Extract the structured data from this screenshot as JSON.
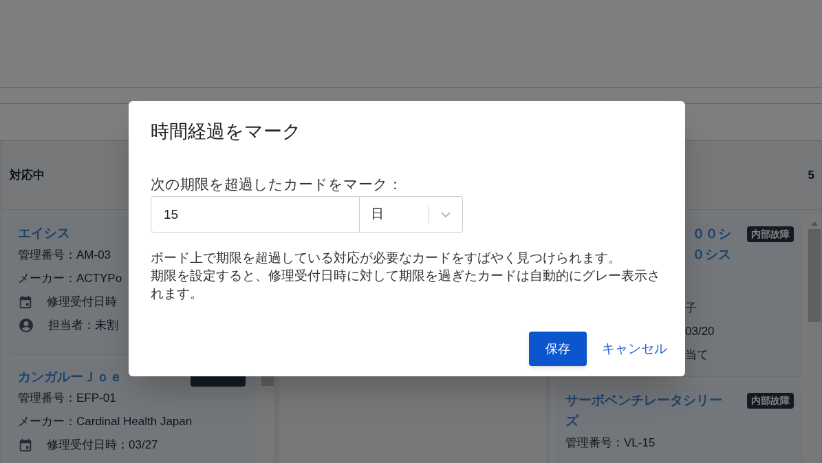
{
  "board": {
    "columns": [
      {
        "kind": "full",
        "title": "対応中",
        "cards": [
          {
            "title": "エイシス",
            "badge_hidden": false,
            "lines": [
              {
                "kind": "text",
                "text": "管理番号：AM-03"
              },
              {
                "kind": "text",
                "text": "メーカー：ACTYPo"
              },
              {
                "kind": "date",
                "text": "修理受付日時"
              },
              {
                "kind": "assignee",
                "text": "担当者：未割"
              }
            ]
          },
          {
            "title": "カンガルーＪｏｅ",
            "badge_hidden": true,
            "lines": [
              {
                "kind": "text",
                "text": "管理番号：EFP-01"
              },
              {
                "kind": "text",
                "text": "メーカー：Cardinal Health Japan"
              },
              {
                "kind": "date",
                "text": "修理受付日時：03/27"
              }
            ]
          }
        ]
      },
      {
        "kind": "covered",
        "count": "5",
        "cards": [
          {
            "title_lines": [
              "００シ",
              "０シス"
            ],
            "badge": "内部故障",
            "lines": [
              {
                "text": "子"
              },
              {
                "text": "03/20"
              },
              {
                "text": "当て"
              }
            ]
          },
          {
            "title_lines": [
              "サーボベンチレータシリーズ"
            ],
            "badge": "内部故障",
            "lines": [
              {
                "text": "管理番号：VL-15"
              }
            ]
          }
        ]
      }
    ]
  },
  "dialog": {
    "title": "時間経過をマーク",
    "label": "次の期限を超過したカードをマーク：",
    "value": "15",
    "unit": "日",
    "description": [
      "ボード上で期限を超過している対応が必要なカードをすばやく見つけられます。",
      "期限を設定すると、修理受付日時に対して期限を過ぎたカードは自動的にグレー表示されます。"
    ],
    "buttons": [
      {
        "kind": "primary",
        "label": "保存"
      },
      {
        "kind": "link",
        "label": "キャンセル"
      }
    ]
  }
}
